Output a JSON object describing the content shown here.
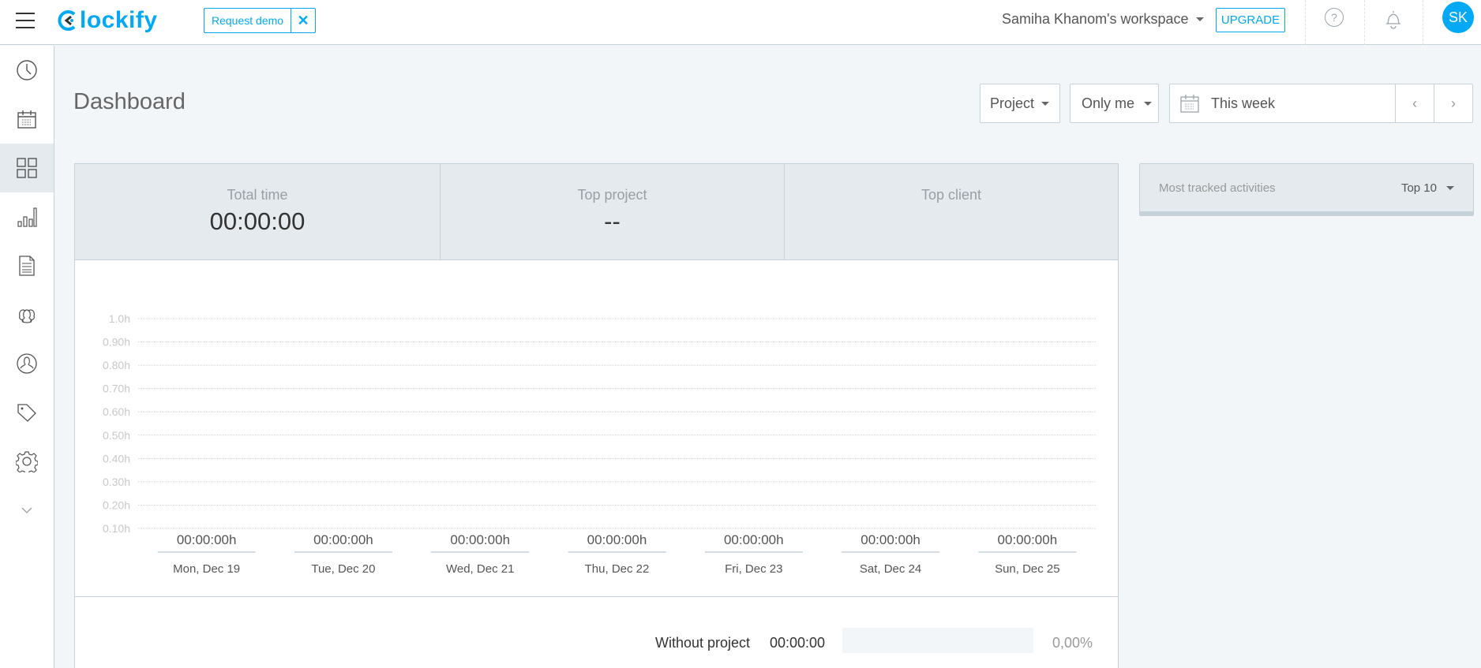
{
  "app": {
    "logo_text": "lockify",
    "brand_color": "#03a9f4"
  },
  "topbar": {
    "request_demo": "Request demo",
    "close_symbol": "✕",
    "workspace": "Samiha Khanom's workspace",
    "upgrade": "UPGRADE",
    "help_symbol": "?",
    "avatar_initials": "SK"
  },
  "sidebar": {
    "items": [
      {
        "name": "time-tracker",
        "icon": "clock-icon",
        "active": false
      },
      {
        "name": "calendar",
        "icon": "calendar-icon",
        "active": false
      },
      {
        "name": "dashboard",
        "icon": "dashboard-grid-icon",
        "active": true
      },
      {
        "name": "reports",
        "icon": "bar-chart-icon",
        "active": false
      },
      {
        "name": "projects",
        "icon": "document-icon",
        "active": false
      },
      {
        "name": "team",
        "icon": "team-icon",
        "active": false
      },
      {
        "name": "clients",
        "icon": "user-circle-icon",
        "active": false
      },
      {
        "name": "tags",
        "icon": "tag-icon",
        "active": false
      },
      {
        "name": "settings",
        "icon": "gear-icon",
        "active": false
      },
      {
        "name": "more",
        "icon": "chevron-down-icon",
        "active": false
      }
    ]
  },
  "page": {
    "title": "Dashboard",
    "filters": {
      "group_by": "Project",
      "scope": "Only me",
      "date_range": "This week",
      "prev": "‹",
      "next": "›"
    }
  },
  "stats": [
    {
      "label": "Total time",
      "value": "00:00:00"
    },
    {
      "label": "Top project",
      "value": "--"
    },
    {
      "label": "Top client",
      "value": ""
    }
  ],
  "activities": {
    "title": "Most tracked activities",
    "top_selector": "Top 10"
  },
  "chart_data": {
    "type": "bar",
    "title": "",
    "xlabel": "",
    "ylabel": "",
    "ylim": [
      0.1,
      1.0
    ],
    "yticks": [
      "1.0h",
      "0.90h",
      "0.80h",
      "0.70h",
      "0.60h",
      "0.50h",
      "0.40h",
      "0.30h",
      "0.20h",
      "0.10h"
    ],
    "grid": true,
    "categories": [
      "Mon, Dec 19",
      "Tue, Dec 20",
      "Wed, Dec 21",
      "Thu, Dec 22",
      "Fri, Dec 23",
      "Sat, Dec 24",
      "Sun, Dec 25"
    ],
    "values": [
      0,
      0,
      0,
      0,
      0,
      0,
      0
    ],
    "value_labels": [
      "00:00:00h",
      "00:00:00h",
      "00:00:00h",
      "00:00:00h",
      "00:00:00h",
      "00:00:00h",
      "00:00:00h"
    ]
  },
  "breakdown": {
    "label": "Without project",
    "time": "00:00:00",
    "percent_value": 0,
    "percent_text": "0,00%"
  }
}
